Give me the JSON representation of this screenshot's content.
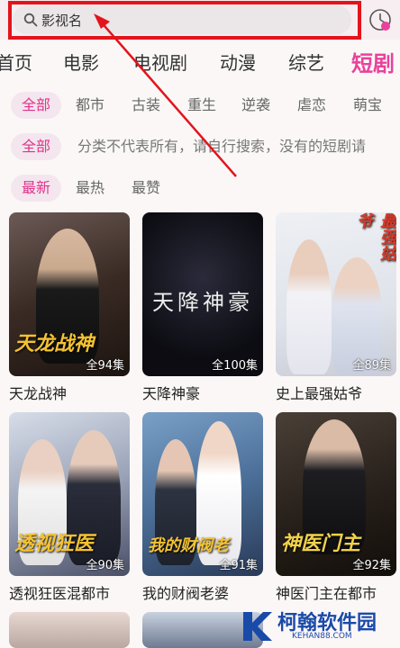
{
  "search": {
    "placeholder": "影视名"
  },
  "category_tabs": [
    "首页",
    "电影",
    "电视剧",
    "动漫",
    "综艺",
    "短剧"
  ],
  "filters": {
    "genre": [
      "全部",
      "都市",
      "古装",
      "重生",
      "逆袭",
      "虐恋",
      "萌宝"
    ],
    "category": {
      "all": "全部",
      "note": "分类不代表所有，请自行搜索，没有的短剧请"
    },
    "sort": [
      "最新",
      "最热",
      "最赞"
    ]
  },
  "dramas": [
    {
      "title": "天龙战神",
      "episodes": "全94集",
      "poster_text": "天龙战神"
    },
    {
      "title": "天降神豪",
      "episodes": "全100集",
      "poster_text": "天降神豪"
    },
    {
      "title": "史上最强姑爷",
      "episodes": "全89集",
      "poster_text": "最强姑爷"
    },
    {
      "title": "透视狂医混都市",
      "episodes": "全90集",
      "poster_text": "透视狂医"
    },
    {
      "title": "我的财阀老婆",
      "episodes": "全91集",
      "poster_text": "我的财阀老"
    },
    {
      "title": "神医门主在都市",
      "episodes": "全92集",
      "poster_text": "神医门主"
    }
  ],
  "watermark": {
    "name": "柯翰软件园",
    "url": "KEHAN88.COM"
  },
  "colors": {
    "accent": "#e8429c",
    "highlight": "#e3141b",
    "watermark": "#1a4aa8"
  }
}
